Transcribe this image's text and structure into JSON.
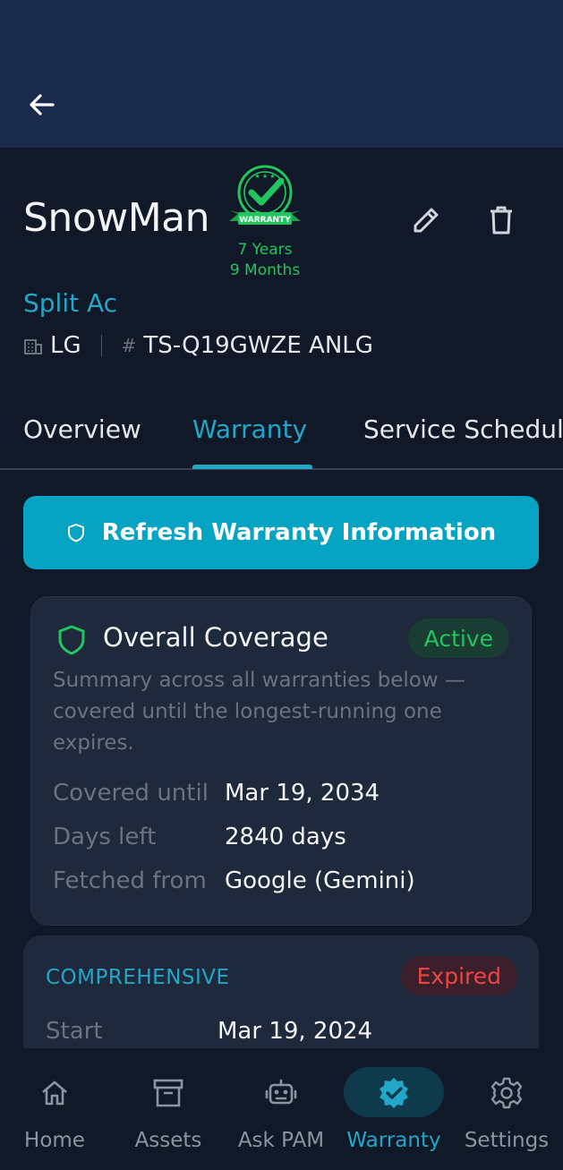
{
  "asset": {
    "name": "SnowMan",
    "warranty_badge_text": "WARRANTY",
    "warranty_duration_years": "7 Years",
    "warranty_duration_months": "9 Months",
    "category": "Split Ac",
    "brand": "LG",
    "model": "TS-Q19GWZE ANLG"
  },
  "tabs": [
    {
      "label": "Overview",
      "active": false
    },
    {
      "label": "Warranty",
      "active": true
    },
    {
      "label": "Service Schedule",
      "active": false
    }
  ],
  "refresh_button": {
    "label": "Refresh Warranty Information"
  },
  "overall_coverage": {
    "title": "Overall Coverage",
    "status": "Active",
    "description": "Summary across all warranties below — covered until the longest-running one expires.",
    "rows": [
      {
        "label": "Covered until",
        "value": "Mar 19, 2034"
      },
      {
        "label": "Days left",
        "value": "2840 days"
      },
      {
        "label": "Fetched from",
        "value": "Google (Gemini)"
      }
    ]
  },
  "comprehensive": {
    "title": "COMPREHENSIVE",
    "status": "Expired",
    "rows": [
      {
        "label": "Start",
        "value": "Mar 19, 2024"
      }
    ]
  },
  "bottom_nav": [
    {
      "label": "Home",
      "icon": "home-icon",
      "active": false
    },
    {
      "label": "Assets",
      "icon": "archive-box-icon",
      "active": false
    },
    {
      "label": "Ask PAM",
      "icon": "robot-icon",
      "active": false
    },
    {
      "label": "Warranty",
      "icon": "verified-badge-icon",
      "active": true
    },
    {
      "label": "Settings",
      "icon": "gear-icon",
      "active": false
    }
  ],
  "colors": {
    "accent": "#22a7c8",
    "header_bg": "#1a2a4c",
    "success": "#22c55e",
    "danger": "#ef4444"
  }
}
